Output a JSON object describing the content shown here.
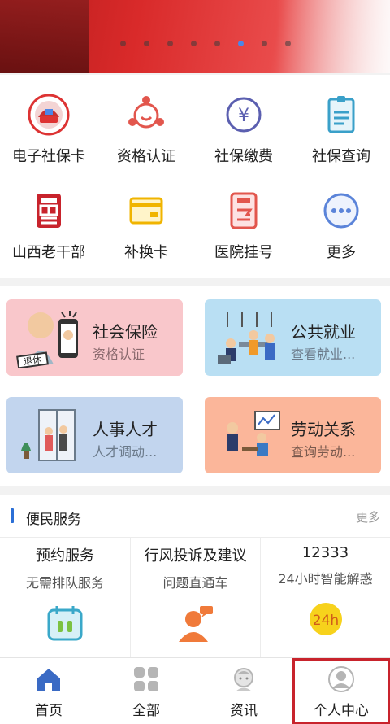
{
  "banner": {
    "dot_count": 8,
    "active_dot": 5
  },
  "services": [
    {
      "label": "电子社保卡",
      "icon": "social-security-card-icon"
    },
    {
      "label": "资格认证",
      "icon": "qualification-icon"
    },
    {
      "label": "社保缴费",
      "icon": "payment-icon"
    },
    {
      "label": "社保查询",
      "icon": "query-document-icon"
    },
    {
      "label": "山西老干部",
      "icon": "veteran-cadre-icon"
    },
    {
      "label": "补换卡",
      "icon": "card-icon"
    },
    {
      "label": "医院挂号",
      "icon": "hospital-icon"
    },
    {
      "label": "更多",
      "icon": "more-icon"
    }
  ],
  "cards": [
    {
      "title": "社会保险",
      "subtitle": "资格认证",
      "badge": "退休"
    },
    {
      "title": "公共就业",
      "subtitle": "查看就业..."
    },
    {
      "title": "人事人才",
      "subtitle": "人才调动..."
    },
    {
      "title": "劳动关系",
      "subtitle": "查询劳动..."
    }
  ],
  "convenience": {
    "title": "便民服务",
    "more": "更多",
    "items": [
      {
        "title": "预约服务",
        "subtitle": "无需排队服务",
        "icon": "calendar-icon"
      },
      {
        "title": "行风投诉及建议",
        "subtitle": "问题直通车",
        "icon": "support-agent-icon"
      },
      {
        "title": "12333",
        "subtitle": "24小时智能解惑",
        "icon": "24h-icon",
        "badge": "24h"
      }
    ]
  },
  "nav": {
    "items": [
      {
        "label": "首页",
        "icon": "home-icon"
      },
      {
        "label": "全部",
        "icon": "grid-icon"
      },
      {
        "label": "资讯",
        "icon": "news-icon"
      },
      {
        "label": "个人中心",
        "icon": "user-icon"
      }
    ]
  },
  "colors": {
    "accent": "#2b6fd6",
    "highlight": "#c8232c",
    "banner": "#d92a2a"
  }
}
